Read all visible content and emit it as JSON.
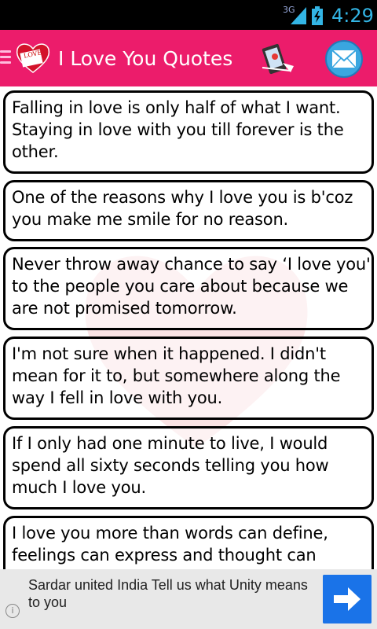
{
  "status_bar": {
    "network": "3G",
    "time": "4:29"
  },
  "app_bar": {
    "title": "I Love You Quotes",
    "logo_text": "LOVE",
    "menu_icon": "hamburger-icon",
    "share_icon": "share-map-phone-icon",
    "mail_icon": "mail-icon"
  },
  "quotes": [
    "Falling in love is only half of what I want. Staying in love with you till forever is the other.",
    "One of the reasons why I love you is b'coz you make me smile for no reason.",
    "Never throw away chance to say ‘I love you' to the people you care about because we are not promised tomorrow.",
    "I'm not sure when it happened. I didn't mean for it to, but somewhere along the way I fell in love with you.",
    "If I only had one minute to live, I would spend all sixty seconds telling you how much I love you.",
    "I love you more than words can define, feelings can express and thought can"
  ],
  "ad": {
    "text": "Sardar united India Tell us what Unity means to you",
    "info_icon": "info-icon",
    "arrow_icon": "arrow-right-icon"
  },
  "colors": {
    "appbar": "#ec1c6b",
    "accent_blue": "#1a73e8",
    "status_time": "#33b5e5"
  }
}
